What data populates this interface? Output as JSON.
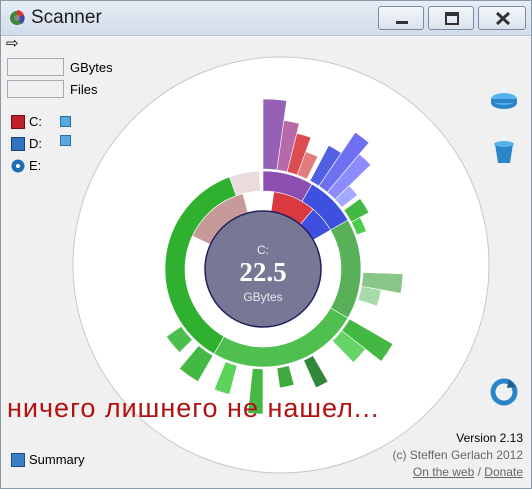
{
  "window": {
    "title": "Scanner",
    "icon": "scanner-app-icon",
    "controls": [
      "minimize-icon",
      "maximize-icon",
      "close-icon"
    ]
  },
  "toolbar": {
    "back_icon": "arrow-right-icon"
  },
  "stats": {
    "size_value": "",
    "size_label": "GBytes",
    "files_value": "",
    "files_label": "Files"
  },
  "drives": [
    {
      "label": "C:",
      "icon": "hard-drive-red-icon",
      "color": "#c0202a"
    },
    {
      "label": "D:",
      "icon": "hard-drive-blue-icon",
      "color": "#2f74c0"
    },
    {
      "label": "E:",
      "icon": "cd-drive-icon",
      "color": "#1f6fb5"
    }
  ],
  "expand_icons": [
    "plus-icon",
    "minus-icon"
  ],
  "side_buttons": [
    "drive-icon",
    "trash-icon",
    "refresh-icon"
  ],
  "chart": {
    "center_drive": "C:",
    "center_value": "22.5",
    "center_unit": "GBytes",
    "colors": {
      "green": "#2fb12f",
      "dark_green": "#1c7a24",
      "red": "#d9393f",
      "purple": "#8c4fb0",
      "blue": "#3f4fe0",
      "center": "#787896",
      "beige": "#c79a9a"
    }
  },
  "overlay_text": "ничего лишнего не нашел...",
  "footer": {
    "summary_label": "Summary",
    "version": "Version 2.13",
    "copyright": "(c) Steffen Gerlach 2012",
    "link_web": "On the web",
    "separator": " / ",
    "link_donate": "Donate"
  }
}
